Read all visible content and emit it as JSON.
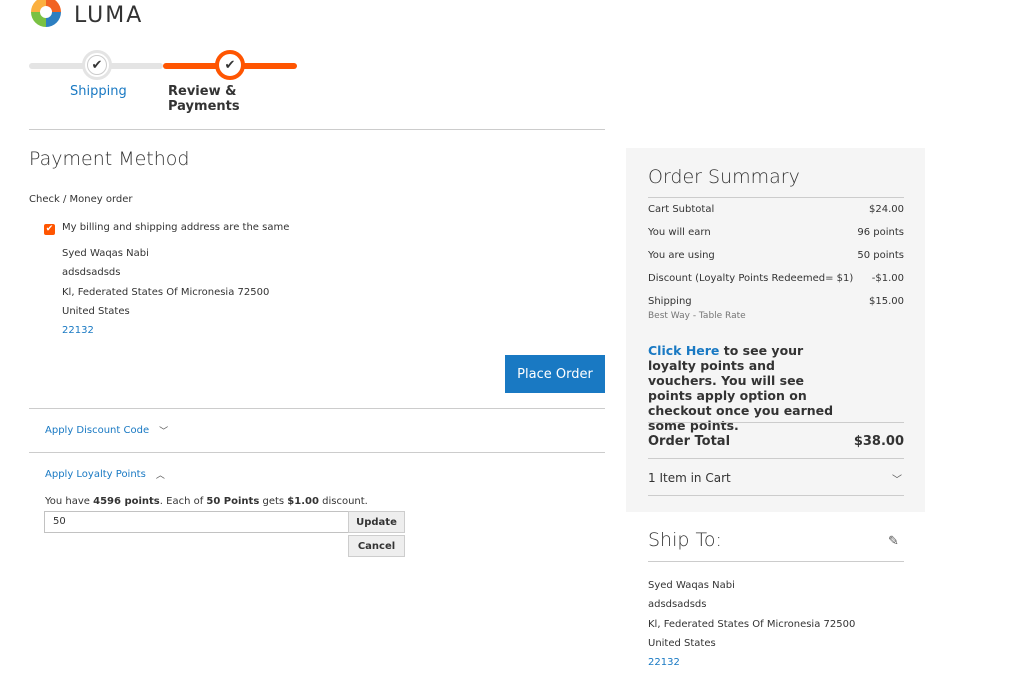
{
  "logo": {
    "text": "LUMA",
    "icon": "luma-logo-icon"
  },
  "progress": {
    "steps": [
      {
        "label": "Shipping",
        "state": "complete"
      },
      {
        "label": "Review & Payments",
        "state": "active"
      }
    ],
    "colors": {
      "active": "#ff5501",
      "inactive": "#e4e4e4"
    }
  },
  "payment": {
    "title": "Payment Method",
    "method": "Check / Money order",
    "same_address_label": "My billing and shipping address are the same",
    "same_address_checked": true,
    "address": {
      "name": "Syed Waqas Nabi",
      "street": "adsdsadsds",
      "city_line": "Kl, Federated States Of Micronesia 72500",
      "country": "United States",
      "phone": "22132"
    },
    "place_order_label": "Place Order"
  },
  "discount": {
    "label": "Apply Discount Code",
    "icon": "chevron-down-icon"
  },
  "loyalty": {
    "label": "Apply Loyalty Points",
    "icon": "chevron-up-icon",
    "text_prefix": "You have ",
    "points": "4596 points",
    "text_mid": ". Each of ",
    "each": "50 Points",
    "text_gets": " gets ",
    "discount": "$1.00",
    "text_suffix": " discount.",
    "input_value": "50",
    "update_label": "Update",
    "cancel_label": "Cancel"
  },
  "summary": {
    "title": "Order Summary",
    "rows": [
      {
        "label": "Cart Subtotal",
        "value": "$24.00"
      },
      {
        "label": "You will earn",
        "value": "96 points"
      },
      {
        "label": "You are using",
        "value": "50 points"
      },
      {
        "label": "Discount (Loyalty Points Redeemed= $1)",
        "value": "-$1.00"
      },
      {
        "label": "Shipping",
        "value": "$15.00"
      }
    ],
    "shipping_method": "Best Way - Table Rate",
    "promo_link": "Click Here",
    "promo_text": " to see your loyalty points and vouchers. You will see points apply option on checkout once you earned some points.",
    "total_label": "Order Total",
    "total_value": "$38.00",
    "items_label": "1 Item in Cart"
  },
  "ship_to": {
    "title": "Ship To:",
    "edit_icon": "pencil-icon",
    "name": "Syed Waqas Nabi",
    "street": "adsdsadsds",
    "city_line": "Kl, Federated States Of Micronesia 72500",
    "country": "United States",
    "phone": "22132"
  }
}
